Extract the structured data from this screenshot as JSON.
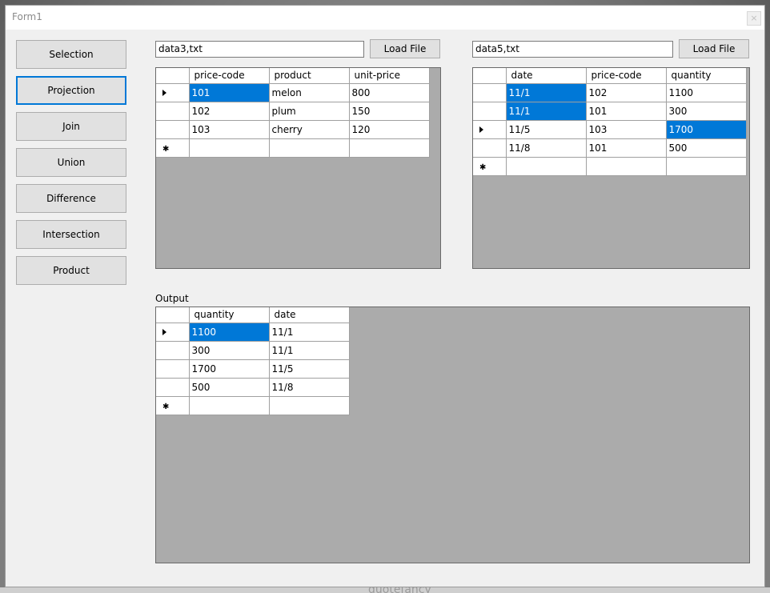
{
  "window": {
    "title": "Form1",
    "close_glyph": "×"
  },
  "operations": [
    {
      "label": "Selection"
    },
    {
      "label": "Projection"
    },
    {
      "label": "Join"
    },
    {
      "label": "Union"
    },
    {
      "label": "Difference"
    },
    {
      "label": "Intersection"
    },
    {
      "label": "Product"
    }
  ],
  "left_file": {
    "value": "data3,txt",
    "button_label": "Load File"
  },
  "right_file": {
    "value": "data5,txt",
    "button_label": "Load File"
  },
  "left_grid": {
    "columns": [
      "price-code",
      "product",
      "unit-price"
    ],
    "rows": [
      [
        "101",
        "melon",
        "800"
      ],
      [
        "102",
        "plum",
        "150"
      ],
      [
        "103",
        "cherry",
        "120"
      ]
    ]
  },
  "right_grid": {
    "columns": [
      "date",
      "price-code",
      "quantity"
    ],
    "rows": [
      [
        "11/1",
        "102",
        "1100"
      ],
      [
        "11/1",
        "101",
        "300"
      ],
      [
        "11/5",
        "103",
        "1700"
      ],
      [
        "11/8",
        "101",
        "500"
      ]
    ]
  },
  "output": {
    "label": "Output",
    "columns": [
      "quantity",
      "date"
    ],
    "rows": [
      [
        "1100",
        "11/1"
      ],
      [
        "300",
        "11/1"
      ],
      [
        "1700",
        "11/5"
      ],
      [
        "500",
        "11/8"
      ]
    ]
  },
  "background_text": "quotefancy",
  "colors": {
    "selection": "#0078d7",
    "grid_background": "#ababab",
    "focus_border": "#0078d7"
  }
}
